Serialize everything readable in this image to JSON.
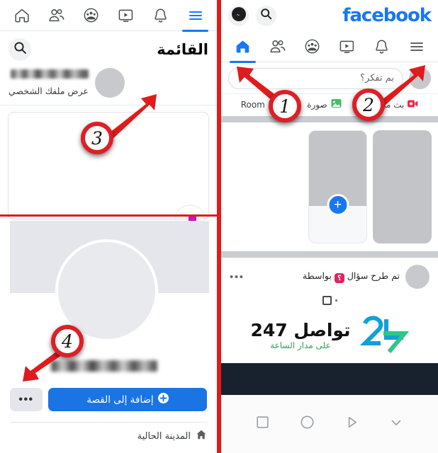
{
  "meta": {
    "accent_red": "#e01b1b",
    "facebook_blue": "#1877f2",
    "marker_red": "#dd1f26"
  },
  "left_panel": {
    "nav_tabs": [
      {
        "name": "home",
        "icon": "home-icon",
        "active": false
      },
      {
        "name": "friends",
        "icon": "friends-icon",
        "active": false
      },
      {
        "name": "groups",
        "icon": "groups-icon",
        "active": false
      },
      {
        "name": "watch",
        "icon": "watch-video-icon",
        "active": false
      },
      {
        "name": "notifications",
        "icon": "bell-icon",
        "active": false
      },
      {
        "name": "menu",
        "icon": "hamburger-menu-icon",
        "active": true
      }
    ],
    "menu_title": "القائمة",
    "search_icon": "search-icon",
    "profile": {
      "name_redacted": "",
      "view_profile_label": "عرض ملفك الشخصي"
    },
    "story_button_label": "إضافة إلى القصة",
    "story_button_icon": "plus-circle-icon",
    "more_button_label": "•••",
    "city_label": "المدينة الحالية",
    "city_icon": "home-filled-icon"
  },
  "right_panel": {
    "header": {
      "messenger_icon": "messenger-icon",
      "search_icon": "search-icon",
      "wordmark": "facebook"
    },
    "nav_tabs": [
      {
        "name": "home",
        "icon": "home-icon",
        "active": true
      },
      {
        "name": "friends",
        "icon": "friends-icon",
        "active": false
      },
      {
        "name": "groups",
        "icon": "groups-icon",
        "active": false
      },
      {
        "name": "watch",
        "icon": "watch-video-icon",
        "active": false
      },
      {
        "name": "notifications",
        "icon": "bell-icon",
        "active": false
      },
      {
        "name": "menu",
        "icon": "hamburger-menu-icon",
        "active": false
      }
    ],
    "composer": {
      "placeholder": "بم تفكر؟"
    },
    "actions": [
      {
        "label": "بث مباشر",
        "icon": "live-video-icon",
        "color": "#f02849"
      },
      {
        "label": "صورة",
        "icon": "photo-icon",
        "color": "#45bd62"
      },
      {
        "label": "Room",
        "icon": "room-icon",
        "color": "#8a3ab9"
      }
    ],
    "stories": [
      {
        "type": "story",
        "label": ""
      },
      {
        "type": "create-story",
        "label": "",
        "badge": "+"
      }
    ],
    "post": {
      "title_prefix": "تم طرح سؤال",
      "title_suffix": "بواسطة",
      "question_badge": "؟",
      "more_dots": "•••"
    },
    "brand": {
      "logo_mark": "247",
      "title": "تواصل 247",
      "subtitle": "على مدار الساعة"
    },
    "android_nav": [
      {
        "name": "recents",
        "icon": "square-icon"
      },
      {
        "name": "home",
        "icon": "circle-icon"
      },
      {
        "name": "back",
        "icon": "triangle-icon"
      },
      {
        "name": "hide-nav",
        "icon": "chevron-down-icon"
      }
    ]
  },
  "annotations": {
    "markers": [
      {
        "id": "1",
        "label": "1"
      },
      {
        "id": "2",
        "label": "2"
      },
      {
        "id": "3",
        "label": "3"
      },
      {
        "id": "4",
        "label": "4"
      }
    ]
  }
}
